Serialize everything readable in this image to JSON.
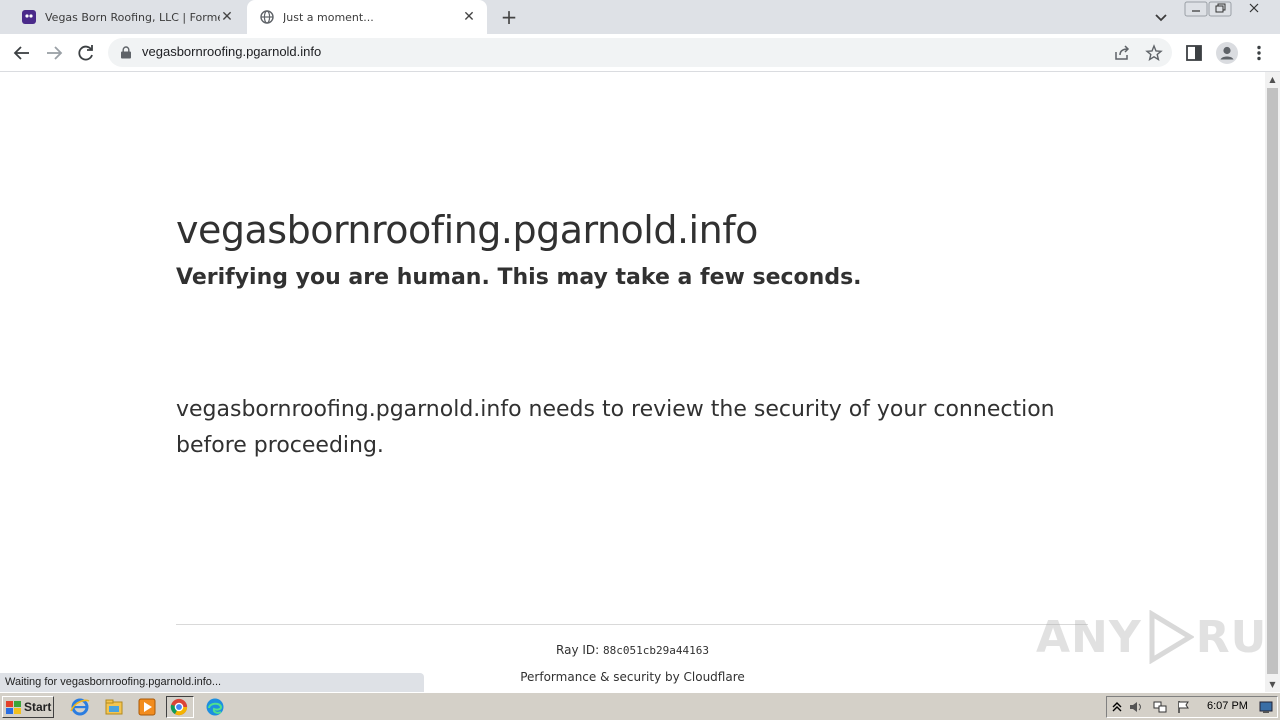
{
  "browser": {
    "tabs": [
      {
        "title": "Vegas Born Roofing, LLC | Formester",
        "active": false
      },
      {
        "title": "Just a moment...",
        "active": true
      }
    ],
    "new_tab_symbol": "+",
    "close_symbol": "✕",
    "address": "vegasbornroofing.pgarnold.info",
    "status_text": "Waiting for vegasbornroofing.pgarnold.info..."
  },
  "page": {
    "site_title": "vegasbornroofing.pgarnold.info",
    "subtitle": "Verifying you are human. This may take a few seconds.",
    "review_text": "vegasbornroofing.pgarnold.info needs to review the security of your connection before proceeding.",
    "ray_label": "Ray ID:",
    "ray_id": "88c051cb29a44163",
    "performance_text": "Performance & security by Cloudflare"
  },
  "watermark": {
    "left": "ANY",
    "right": "RUN"
  },
  "taskbar": {
    "start_label": "Start",
    "clock": "6:07 PM"
  },
  "colors": {
    "tabstrip": "#dee1e6",
    "omnibox": "#f1f3f4",
    "text": "#313131",
    "taskbar": "#d4d0c8"
  }
}
